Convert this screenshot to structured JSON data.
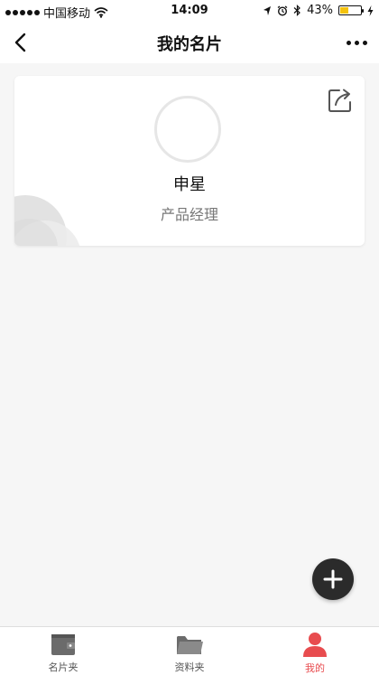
{
  "status_bar": {
    "carrier": "中国移动",
    "time": "14:09",
    "battery_percent": "43%",
    "battery_level": 0.43,
    "icons": [
      "signal-icon",
      "wifi-icon",
      "location-icon",
      "alarm-icon",
      "bluetooth-icon",
      "charging-icon"
    ]
  },
  "nav": {
    "title": "我的名片",
    "back_icon": "back-chevron-icon",
    "more_icon": "more-dots-icon"
  },
  "card": {
    "name": "申星",
    "role": "产品经理",
    "share_icon": "share-icon"
  },
  "fab": {
    "icon": "plus-icon"
  },
  "tabs": [
    {
      "label": "名片夹",
      "icon": "wallet-icon",
      "active": false
    },
    {
      "label": "资料夹",
      "icon": "folder-icon",
      "active": false
    },
    {
      "label": "我的",
      "icon": "user-icon",
      "active": true
    }
  ],
  "colors": {
    "accent": "#e84c4f",
    "background": "#f6f6f6",
    "fab": "#2b2b2b",
    "battery_fill": "#f4c20d"
  }
}
